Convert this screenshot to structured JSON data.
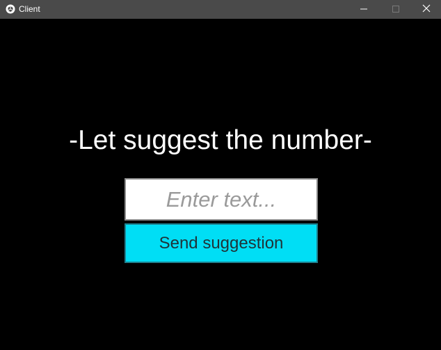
{
  "window": {
    "title": "Client",
    "icon": "unity-icon",
    "controls": {
      "minimize_icon": "minimize-icon",
      "maximize_icon": "maximize-icon",
      "close_icon": "close-icon"
    }
  },
  "main": {
    "heading": "-Let suggest the number-",
    "input": {
      "value": "",
      "placeholder": "Enter text..."
    },
    "send_button_label": "Send suggestion"
  },
  "colors": {
    "titlebar": "#4a4a4a",
    "background": "#000000",
    "button": "#00def5",
    "heading": "#ffffff"
  }
}
